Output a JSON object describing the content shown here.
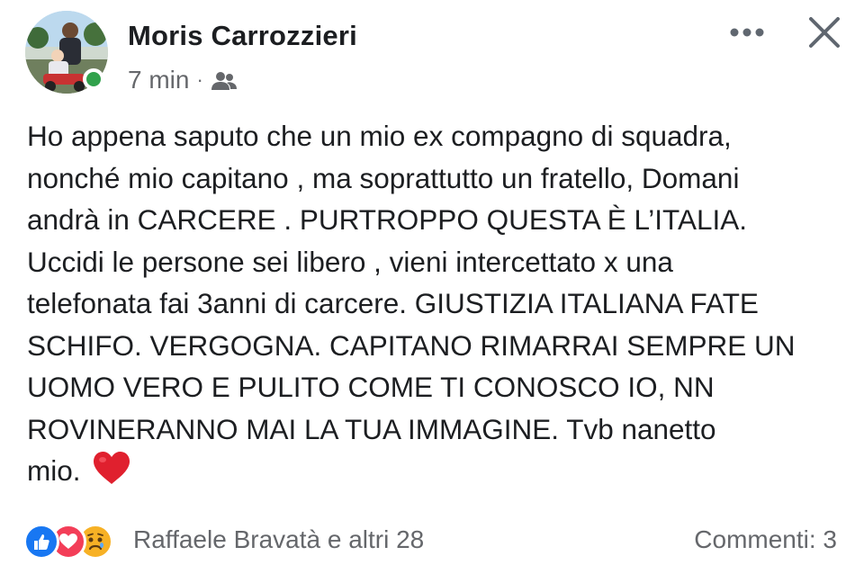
{
  "post": {
    "author": "Moris Carrozzieri",
    "time": "7 min",
    "separator": "·",
    "audience_icon": "friends-icon",
    "online_status_color": "#31a24c",
    "text": "Ho appena saputo che un mio ex compagno di squadra,\nnonché mio capitano , ma soprattutto un fratello, Domani\nandrà in CARCERE . PURTROPPO QUESTA È L’ITALIA.\nUccidi le persone sei libero , vieni intercettato x una\ntelefonata fai 3anni di carcere. GIUSTIZIA ITALIANA FATE\nSCHIFO. VERGOGNA. CAPITANO RIMARRAI SEMPRE UN\nUOMO VERO E PULITO COME TI CONOSCO IO, NN\nROVINERANNO MAI LA TUA IMMAGINE. Tvb nanetto\nmio.",
    "emoji": "red-heart"
  },
  "header": {
    "more_icon": "more-options-icon",
    "close_icon": "close-icon"
  },
  "footer": {
    "reactions": [
      "like",
      "love",
      "sad"
    ],
    "reactors_text": "Raffaele Bravatà e altri 28",
    "comments_text": "Commenti: 3"
  },
  "colors": {
    "text": "#1c1e21",
    "secondary_text": "#65676b",
    "like_blue": "#1877f2",
    "love_red": "#f33e58",
    "sad_yellow": "#f7b125"
  }
}
